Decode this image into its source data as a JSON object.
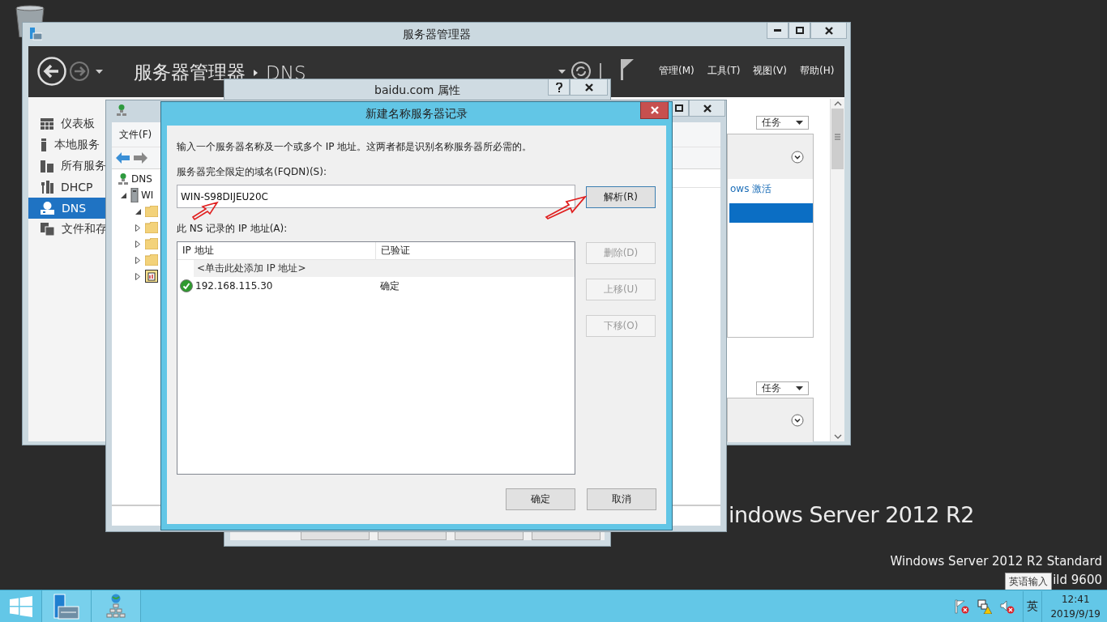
{
  "desktop": {
    "brand": "indows Server 2012 R2",
    "edition": "Windows Server 2012 R2 Standard",
    "build": "ild 9600"
  },
  "server_manager": {
    "title": "服务器管理器",
    "breadcrumb": "服务器管理器",
    "page": "DNS",
    "menu": [
      "管理(M)",
      "工具(T)",
      "视图(V)",
      "帮助(H)"
    ],
    "nav": [
      {
        "label": "仪表板",
        "kind": "dashboard",
        "selected": false
      },
      {
        "label": "本地服务",
        "kind": "server",
        "selected": false
      },
      {
        "label": "所有服务",
        "kind": "servers",
        "selected": false
      },
      {
        "label": "DHCP",
        "kind": "tools",
        "selected": false
      },
      {
        "label": "DNS",
        "kind": "dns",
        "selected": true
      },
      {
        "label": "文件和存",
        "kind": "files",
        "selected": false
      }
    ],
    "tasks": [
      "任务",
      "任务"
    ],
    "link": "ows 激活"
  },
  "properties_dialog": {
    "title": "baidu.com 属性"
  },
  "dns_manager": {
    "menu": [
      "文件(F)"
    ],
    "tree": [
      {
        "label": "DNS",
        "kind": "dns",
        "children": [
          {
            "label": "WI",
            "kind": "server",
            "expanded": true,
            "children": [
              {
                "kind": "folder",
                "expanded": true
              },
              {
                "kind": "folder",
                "expanded": false
              },
              {
                "kind": "folder",
                "expanded": false
              },
              {
                "kind": "folder",
                "expanded": false
              },
              {
                "kind": "zone",
                "expanded": false
              }
            ]
          }
        ]
      }
    ]
  },
  "ns_dialog": {
    "title": "新建名称服务器记录",
    "intro": "输入一个服务器名称及一个或多个 IP 地址。这两者都是识别名称服务器所必需的。",
    "fqdn_label": "服务器完全限定的域名(FQDN)(S):",
    "fqdn_value": "WIN-S98DIJEU20C",
    "resolve": "解析(R)",
    "ip_label": "此 NS 记录的 IP 地址(A):",
    "columns": [
      "IP 地址",
      "已验证"
    ],
    "add_row": "<单击此处添加 IP 地址>",
    "rows": [
      {
        "ip": "192.168.115.30",
        "status": "确定",
        "verified": true
      }
    ],
    "side_buttons": [
      {
        "label": "删除(D)",
        "disabled": true
      },
      {
        "label": "上移(U)",
        "disabled": true
      },
      {
        "label": "下移(O)",
        "disabled": true
      }
    ],
    "buttons": [
      "确定",
      "取消"
    ]
  },
  "taskbar": {
    "apps": [
      {
        "kind": "server-manager"
      },
      {
        "kind": "dns"
      }
    ],
    "ime": "英",
    "tooltip": "英语输入",
    "time": "12:41",
    "date": "2019/9/19"
  }
}
